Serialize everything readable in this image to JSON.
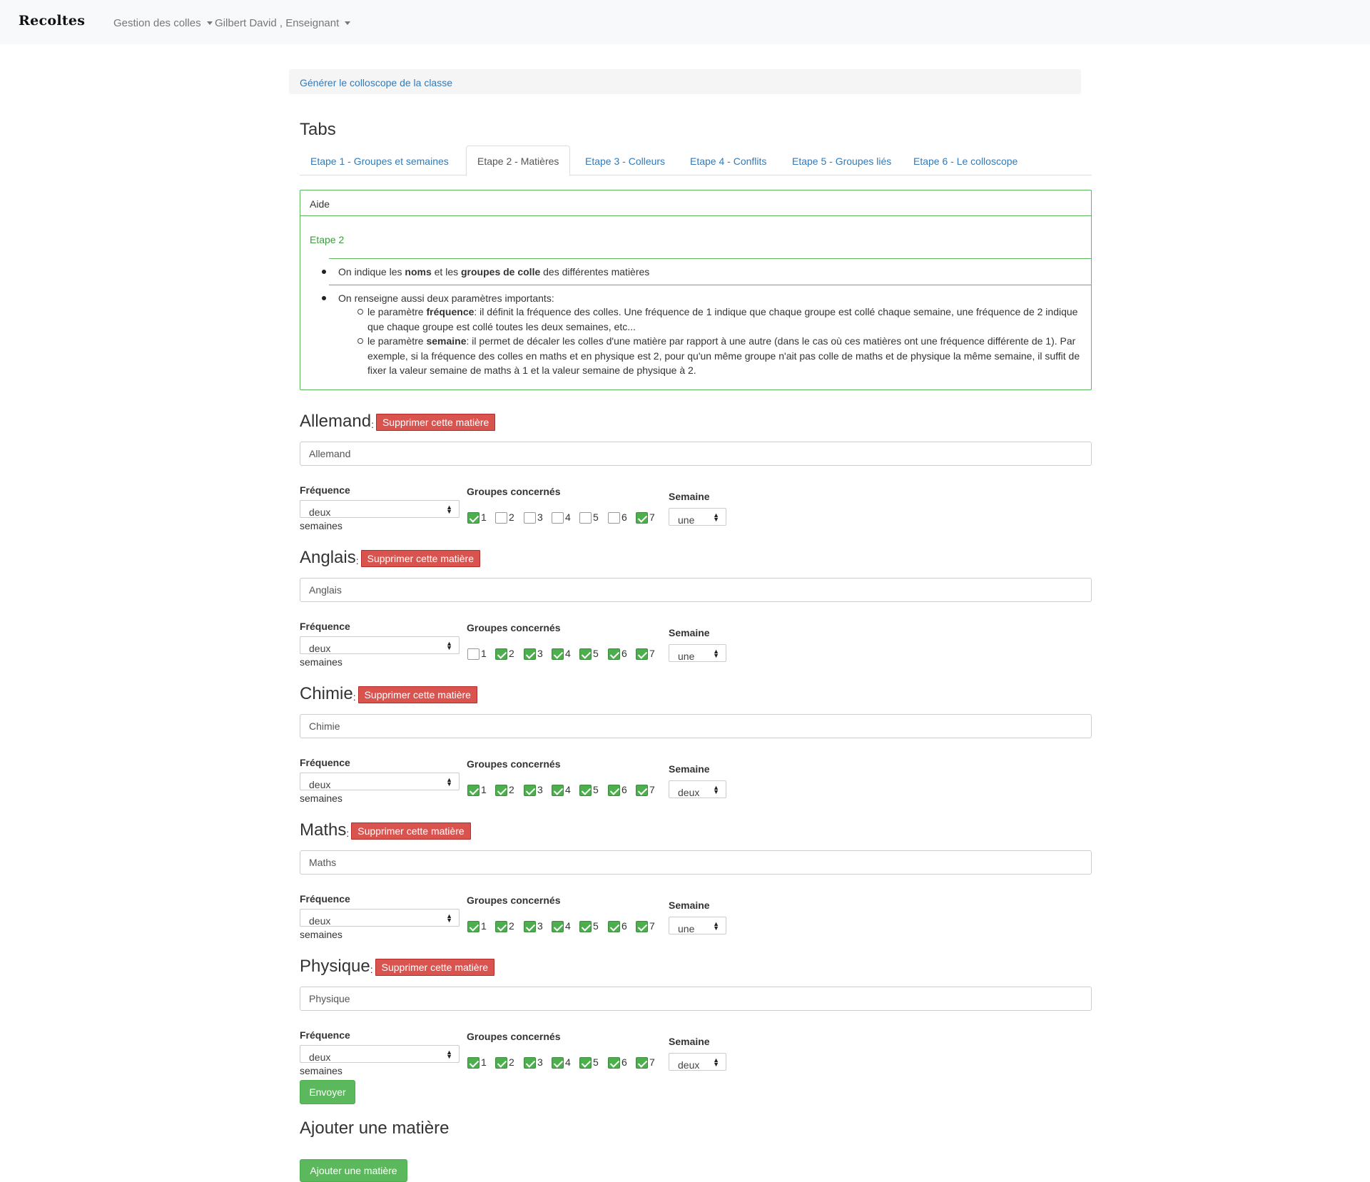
{
  "navbar": {
    "brand": "Recoltes",
    "menu_colles": "Gestion des colles",
    "menu_user": "Gilbert David , Enseignant"
  },
  "actionbar": {
    "link": "Générer le colloscope de la classe"
  },
  "tabs_title": "Tabs",
  "tabs": [
    {
      "label": "Etape 1 - Groupes et semaines",
      "active": false
    },
    {
      "label": "Etape 2 - Matières",
      "active": true
    },
    {
      "label": "Etape 3 - Colleurs",
      "active": false
    },
    {
      "label": "Etape 4 - Conflits",
      "active": false
    },
    {
      "label": "Etape 5 - Groupes liés",
      "active": false
    },
    {
      "label": "Etape 6 - Le colloscope",
      "active": false
    }
  ],
  "aide": {
    "heading": "Aide",
    "subheading": "Etape 2",
    "item1": {
      "t1": "On indique les ",
      "b1": "noms",
      "t2": " et les ",
      "b2": "groupes de colle",
      "t3": " des différentes matières"
    },
    "item2": "On renseigne aussi deux paramètres importants:",
    "sub1": {
      "t1": "le paramètre ",
      "b": "fréquence",
      "t2": ": il définit la fréquence des colles. Une fréquence de 1 indique que chaque groupe est collé chaque semaine, une fréquence de 2 indique que chaque groupe est collé toutes les deux semaines, etc..."
    },
    "sub2": {
      "t1": "le paramètre ",
      "b": "semaine",
      "t2": ": il permet de décaler les colles d'une matière par rapport à une autre (dans le cas où ces matières ont une fréquence différente de 1). Par exemple, si la fréquence des colles en maths et en physique est 2, pour qu'un même groupe n'ait pas colle de maths et de physique la même semaine, il suffit de fixer la valeur semaine de maths à 1 et la valeur semaine de physique à 2."
    }
  },
  "labels": {
    "colon": ":",
    "delete": "Supprimer cette matière",
    "frequence": "Fréquence",
    "groupes": "Groupes concernés",
    "semaine": "Semaine",
    "semaines_suffix": "semaines"
  },
  "matieres": [
    {
      "title": "Allemand",
      "value": "Allemand",
      "frequence": "deux",
      "semaine": "une",
      "groups": [
        true,
        false,
        false,
        false,
        false,
        false,
        true
      ]
    },
    {
      "title": "Anglais",
      "value": "Anglais",
      "frequence": "deux",
      "semaine": "une",
      "groups": [
        false,
        true,
        true,
        true,
        true,
        true,
        true
      ]
    },
    {
      "title": "Chimie",
      "value": "Chimie",
      "frequence": "deux",
      "semaine": "deux",
      "groups": [
        true,
        true,
        true,
        true,
        true,
        true,
        true
      ]
    },
    {
      "title": "Maths",
      "value": "Maths",
      "frequence": "deux",
      "semaine": "une",
      "groups": [
        true,
        true,
        true,
        true,
        true,
        true,
        true
      ]
    },
    {
      "title": "Physique",
      "value": "Physique",
      "frequence": "deux",
      "semaine": "deux",
      "groups": [
        true,
        true,
        true,
        true,
        true,
        true,
        true
      ]
    }
  ],
  "group_labels": [
    "1",
    "2",
    "3",
    "4",
    "5",
    "6",
    "7"
  ],
  "submit_label": "Envoyer",
  "add_section": {
    "title": "Ajouter une matière",
    "button": "Ajouter une matière"
  },
  "colors": {
    "success": "#5cb85c",
    "danger": "#d9534f",
    "link": "#337ab7"
  }
}
